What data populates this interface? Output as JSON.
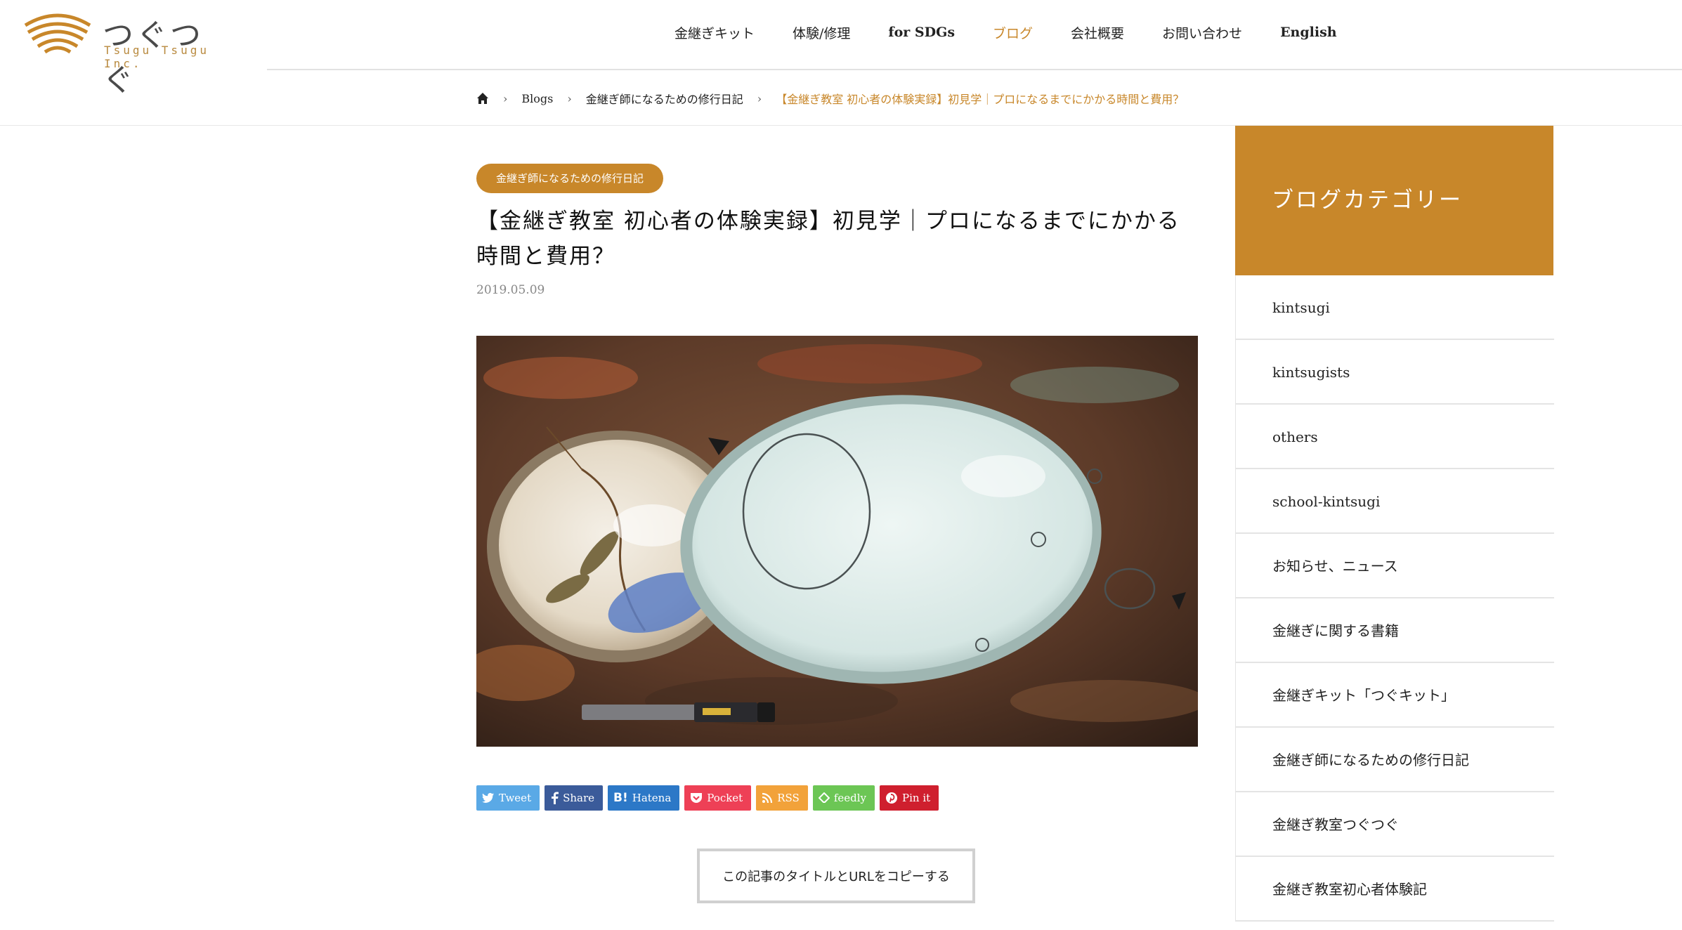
{
  "brand": {
    "name": "つぐつぐ",
    "sub": "Tsugu Tsugu Inc.",
    "accent": "#c8872a"
  },
  "nav": [
    {
      "label": "金継ぎキット"
    },
    {
      "label": "体験/修理"
    },
    {
      "label": "for SDGs"
    },
    {
      "label": "ブログ"
    },
    {
      "label": "会社概要"
    },
    {
      "label": "お問い合わせ"
    },
    {
      "label": "English"
    }
  ],
  "breadcrumb": {
    "home_icon": "home-icon",
    "items": [
      "Blogs",
      "金継ぎ師になるための修行日記"
    ],
    "current": "【金継ぎ教室 初心者の体験実録】初見学｜プロになるまでにかかる時間と費用？"
  },
  "post": {
    "category": "金継ぎ師になるための修行日記",
    "title": "【金継ぎ教室 初心者の体験実録】初見学｜プロになるまでにかかる時間と費用？",
    "date": "2019.05.09"
  },
  "share": [
    {
      "label": "Tweet",
      "icon": "twitter-icon",
      "color": "#5aa9e6"
    },
    {
      "label": "Share",
      "icon": "facebook-icon",
      "color": "#3b5b9a"
    },
    {
      "label": "Hatena",
      "icon": "hatena-icon",
      "color": "#2c78c7"
    },
    {
      "label": "Pocket",
      "icon": "pocket-icon",
      "color": "#ee4056"
    },
    {
      "label": "RSS",
      "icon": "rss-icon",
      "color": "#f2a23a"
    },
    {
      "label": "feedly",
      "icon": "feedly-icon",
      "color": "#6cc655"
    },
    {
      "label": "Pin it",
      "icon": "pinterest-icon",
      "color": "#cf1f2e"
    }
  ],
  "copy_button": "この記事のタイトルとURLをコピーする",
  "sidebar": {
    "heading": "ブログカテゴリー",
    "items": [
      "kintsugi",
      "kintsugists",
      "others",
      "school-kintsugi",
      "お知らせ、ニュース",
      "金継ぎに関する書籍",
      "金継ぎキット「つぐキット」",
      "金継ぎ師になるための修行日記",
      "金継ぎ教室つぐつぐ",
      "金継ぎ教室初心者体験記"
    ]
  }
}
